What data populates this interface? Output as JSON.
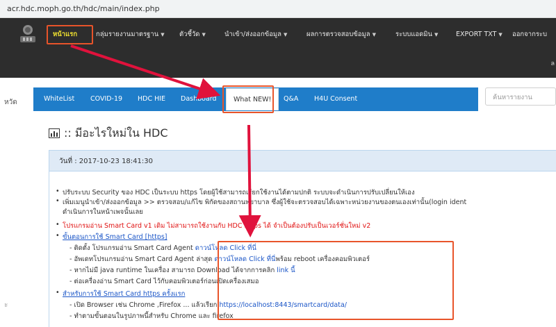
{
  "browser": {
    "url": "acr.hdc.moph.go.th/hdc/main/index.php"
  },
  "topnav": {
    "items": [
      {
        "label": "หน้าแรก",
        "dropdown": false,
        "active": true
      },
      {
        "label": "กลุ่มรายงานมาตรฐาน",
        "dropdown": true
      },
      {
        "label": "ตัวชี้วัด",
        "dropdown": true
      },
      {
        "label": "นำเข้า/ส่งออกข้อมูล",
        "dropdown": true
      },
      {
        "label": "ผลการตรวจสอบข้อมูล",
        "dropdown": true
      },
      {
        "label": "ระบบแอดมิน",
        "dropdown": true
      },
      {
        "label": "EXPORT TXT",
        "dropdown": true
      },
      {
        "label": "ออกจากระบ",
        "dropdown": false
      }
    ],
    "edge_letter": "ล",
    "active_color": "#f0e130"
  },
  "side_fragment": "หวัด",
  "side_dot": "ะ",
  "tabs": [
    {
      "label": "WhiteList"
    },
    {
      "label": "COVID-19"
    },
    {
      "label": "HDC HIE"
    },
    {
      "label": "Dashboard"
    },
    {
      "label": "What NEW!",
      "active": true
    },
    {
      "label": "Q&A"
    },
    {
      "label": "H4U Consent"
    }
  ],
  "search": {
    "placeholder": "ค้นหารายงาน"
  },
  "page": {
    "title": ":: มีอะไรใหม่ใน HDC"
  },
  "panel": {
    "date": "วันที่ : 2017-10-23 18:41:30"
  },
  "content": {
    "l1": "ปรับระบบ Security ของ HDC เป็นระบบ https โดยผู้ใช้สามารถเรียกใช้งานได้ตามปกติ ระบบจะดำเนินการปรับเปลี่ยนให้เอง",
    "l2": "เพิ่มเมนูนำเข้า/ส่งออกข้อมูล >> ตรวจสอบ/แก้ไข พิกัดของสถานพยาบาล ซึ่งผู้ใช้จะตรวจสอบได้เฉพาะหน่วยงานของตนเองเท่านั้น(login ident",
    "l2b": "ดำเนินการในหน้าเพจนั้นเลย",
    "l3": "โปรแกรมอ่าน Smart Card v1 เดิม ไม่สามารถใช้งานกับ HDC https ได้ จำเป็นต้องปรับเป็นเวอร์ชั่นใหม่ v2",
    "l4": "ขั้นตอนการใช้ Smart Card [https]",
    "l5_pre": "- ติดตั้ง โปรแกรมอ่าน Smart Card Agent ",
    "l5_link": "ดาวน์โหลด Click ที่นี่",
    "l6_pre": "- อัพเดทโปรแกรมอ่าน Smart Card Agent ล่าสุด ",
    "l6_link": "ดาวน์โหลด Click ที่นี่",
    "l6_post": "พร้อม reboot เครื่องคอมพิวเตอร์",
    "l7_pre": "- หากไม่มี java runtime ในเครื่อง สามารถ Download ได้จากการคลิก ",
    "l7_link": "link นี้",
    "l8": "- ต่อเครื่องอ่าน Smart Card ไว้กับคอมพิวเตอร์ก่อนเปิดเครื่องเสมอ",
    "l9": "สำหรับการใช้ Smart Card https ครั้งแรก",
    "l10_pre": "- เปิด Browser เช่น Chrome ,Firefox ... แล้วเรียก ",
    "l10_link": "https://localhost:8443/smartcard/data/",
    "l11": "- ทำตามขั้นตอนในรูปภาพนี้สำหรับ Chrome และ firefox"
  },
  "colors": {
    "navbar": "#2d2d2d",
    "tabbar": "#1f7dc9",
    "annotation": "#e8542a",
    "arrow": "#e0123c",
    "link": "#1a55c7",
    "warning": "#e01010"
  }
}
